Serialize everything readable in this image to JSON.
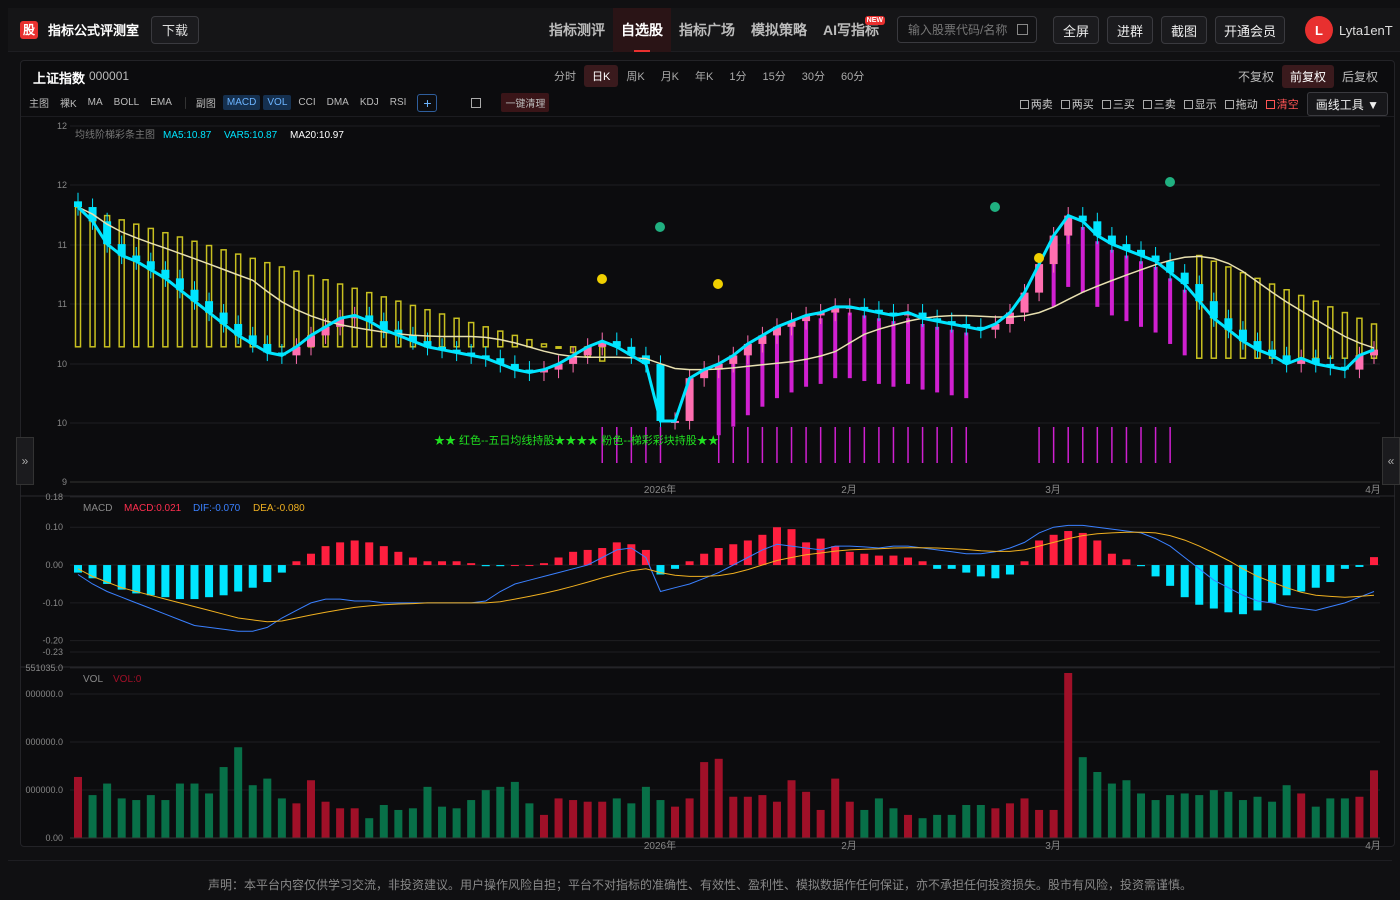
{
  "app": {
    "logo_char": "股",
    "brand": "指标公式评测室",
    "download": "下载"
  },
  "nav": [
    {
      "label": "指标测评",
      "active": false
    },
    {
      "label": "自选股",
      "active": true
    },
    {
      "label": "指标广场",
      "active": false
    },
    {
      "label": "模拟策略",
      "active": false
    },
    {
      "label": "AI写指标",
      "active": false,
      "tag": "NEW"
    }
  ],
  "search": {
    "placeholder": "输入股票代码/名称"
  },
  "top_buttons": [
    "全屏",
    "进群",
    "截图",
    "开通会员"
  ],
  "user": {
    "initial": "L",
    "name": "Lyta1enT"
  },
  "stock": {
    "name": "上证指数",
    "code": "000001"
  },
  "periods": [
    {
      "label": "分时",
      "on": false
    },
    {
      "label": "日K",
      "on": true
    },
    {
      "label": "周K",
      "on": false
    },
    {
      "label": "月K",
      "on": false
    },
    {
      "label": "年K",
      "on": false
    },
    {
      "label": "1分",
      "on": false
    },
    {
      "label": "15分",
      "on": false
    },
    {
      "label": "30分",
      "on": false
    },
    {
      "label": "60分",
      "on": false
    }
  ],
  "fq": [
    {
      "label": "不复权",
      "on": false
    },
    {
      "label": "前复权",
      "on": true
    },
    {
      "label": "后复权",
      "on": false
    }
  ],
  "main_ind": [
    "主图",
    "裸K",
    "MA",
    "BOLL",
    "EMA"
  ],
  "sub_ind": [
    {
      "label": "副图",
      "on": false
    },
    {
      "label": "MACD",
      "on": true
    },
    {
      "label": "VOL",
      "on": true
    },
    {
      "label": "CCI",
      "on": false
    },
    {
      "label": "DMA",
      "on": false
    },
    {
      "label": "KDJ",
      "on": false
    },
    {
      "label": "RSI",
      "on": false
    }
  ],
  "clear_all": "一键清理",
  "tools": [
    {
      "label": "两卖",
      "red": false
    },
    {
      "label": "两买",
      "red": false
    },
    {
      "label": "三买",
      "red": false
    },
    {
      "label": "三卖",
      "red": false
    },
    {
      "label": "显示",
      "red": false
    },
    {
      "label": "拖动",
      "red": false
    },
    {
      "label": "清空",
      "red": true
    }
  ],
  "draw_tools": "画线工具 ▼",
  "footer": "声明：本平台内容仅供学习交流，非投资建议。用户操作风险自担；平台不对指标的准确性、有效性、盈利性、模拟数据作任何保证，亦不承担任何投资损失。股市有风险，投资需谨慎。",
  "colors": {
    "up": "#ff6fb0",
    "down": "#00e5ff",
    "ma5": "#e02020",
    "var5": "#00e5ff",
    "ma20": "#e8e0b0",
    "band": "#c8c020",
    "stair": "#d020d0",
    "macd_up": "#ff1f3f",
    "macd_dn": "#00e5ff",
    "dif": "#3a80ff",
    "dea": "#f0b020",
    "vol_up": "#a01028",
    "vol_dn": "#087048"
  },
  "chart_data": {
    "type": "candlestick",
    "main": {
      "legend": "均线阶梯彩条主图",
      "ma5_label": "MA5:10.87",
      "var5_label": "VAR5:10.87",
      "ma20_label": "MA20:10.97",
      "y_ticks": [
        "12",
        "12",
        "11",
        "11",
        "10",
        "10",
        "9"
      ],
      "note": "★★ 红色--五日均线持股★★★★ 粉色--梯彩彩块持股★★",
      "x_labels": [
        "2026年",
        "2月",
        "3月",
        "4月"
      ]
    },
    "macd": {
      "name": "MACD",
      "macd_label": "MACD:0.021",
      "dif_label": "DIF:-0.070",
      "dea_label": "DEA:-0.080",
      "y_ticks": [
        "0.18",
        "0.10",
        "0.00",
        "-0.10",
        "-0.20",
        "-0.23"
      ]
    },
    "vol": {
      "name": "VOL",
      "vol_label": "VOL:0",
      "y_ticks": [
        "551035.0",
        "000000.0",
        "000000.0",
        "000000.0",
        "0.00"
      ],
      "x_labels": [
        "2026年",
        "2月",
        "3月",
        "4月"
      ]
    },
    "closes": [
      11.85,
      11.8,
      11.72,
      11.68,
      11.66,
      11.63,
      11.6,
      11.56,
      11.52,
      11.48,
      11.44,
      11.4,
      11.37,
      11.34,
      11.33,
      11.36,
      11.4,
      11.43,
      11.46,
      11.47,
      11.45,
      11.42,
      11.4,
      11.38,
      11.36,
      11.35,
      11.34,
      11.33,
      11.32,
      11.3,
      11.28,
      11.27,
      11.28,
      11.3,
      11.33,
      11.36,
      11.38,
      11.36,
      11.33,
      11.3,
      11.1,
      11.1,
      11.25,
      11.28,
      11.3,
      11.33,
      11.37,
      11.4,
      11.43,
      11.45,
      11.47,
      11.48,
      11.5,
      11.5,
      11.49,
      11.48,
      11.47,
      11.48,
      11.46,
      11.45,
      11.44,
      11.43,
      11.42,
      11.44,
      11.48,
      11.55,
      11.65,
      11.75,
      11.82,
      11.8,
      11.75,
      11.72,
      11.7,
      11.68,
      11.66,
      11.62,
      11.58,
      11.52,
      11.46,
      11.42,
      11.38,
      11.35,
      11.33,
      11.3,
      11.32,
      11.3,
      11.29,
      11.28,
      11.33,
      11.35
    ],
    "macd_hist": [
      -0.02,
      -0.035,
      -0.05,
      -0.065,
      -0.075,
      -0.08,
      -0.085,
      -0.09,
      -0.09,
      -0.085,
      -0.08,
      -0.07,
      -0.06,
      -0.045,
      -0.02,
      0.01,
      0.03,
      0.05,
      0.06,
      0.065,
      0.06,
      0.05,
      0.035,
      0.02,
      0.01,
      0.01,
      0.01,
      0.005,
      -0.003,
      -0.003,
      0.0,
      0.0,
      0.005,
      0.02,
      0.035,
      0.04,
      0.045,
      0.06,
      0.055,
      0.04,
      -0.025,
      -0.01,
      0.01,
      0.03,
      0.045,
      0.055,
      0.065,
      0.08,
      0.1,
      0.095,
      0.06,
      0.07,
      0.05,
      0.035,
      0.03,
      0.025,
      0.025,
      0.02,
      0.01,
      -0.01,
      -0.01,
      -0.02,
      -0.03,
      -0.035,
      -0.025,
      0.01,
      0.065,
      0.08,
      0.09,
      0.085,
      0.065,
      0.03,
      0.015,
      -0.003,
      -0.03,
      -0.055,
      -0.085,
      -0.105,
      -0.115,
      -0.125,
      -0.13,
      -0.12,
      -0.1,
      -0.08,
      -0.07,
      -0.06,
      -0.045,
      -0.01,
      -0.005,
      0.021
    ],
    "dif": [
      -0.025,
      -0.05,
      -0.07,
      -0.085,
      -0.1,
      -0.115,
      -0.13,
      -0.145,
      -0.16,
      -0.165,
      -0.17,
      -0.175,
      -0.175,
      -0.165,
      -0.14,
      -0.12,
      -0.1,
      -0.09,
      -0.09,
      -0.095,
      -0.095,
      -0.1,
      -0.1,
      -0.1,
      -0.1,
      -0.1,
      -0.1,
      -0.1,
      -0.095,
      -0.07,
      -0.05,
      -0.04,
      -0.03,
      -0.02,
      -0.01,
      0.0,
      0.02,
      0.04,
      0.045,
      0.02,
      -0.07,
      -0.06,
      -0.05,
      -0.035,
      -0.02,
      0.0,
      0.02,
      0.04,
      0.055,
      0.05,
      0.045,
      0.04,
      0.05,
      0.05,
      0.048,
      0.045,
      0.05,
      0.05,
      0.045,
      0.04,
      0.035,
      0.03,
      0.03,
      0.035,
      0.045,
      0.06,
      0.085,
      0.1,
      0.105,
      0.105,
      0.1,
      0.095,
      0.09,
      0.085,
      0.07,
      0.05,
      0.02,
      -0.01,
      -0.04,
      -0.06,
      -0.08,
      -0.095,
      -0.1,
      -0.11,
      -0.115,
      -0.12,
      -0.11,
      -0.1,
      -0.085,
      -0.07
    ],
    "dea": [
      -0.01,
      -0.03,
      -0.045,
      -0.06,
      -0.07,
      -0.08,
      -0.09,
      -0.1,
      -0.11,
      -0.12,
      -0.13,
      -0.14,
      -0.145,
      -0.15,
      -0.148,
      -0.14,
      -0.132,
      -0.125,
      -0.118,
      -0.112,
      -0.108,
      -0.105,
      -0.103,
      -0.102,
      -0.1,
      -0.1,
      -0.1,
      -0.1,
      -0.1,
      -0.097,
      -0.09,
      -0.083,
      -0.075,
      -0.066,
      -0.056,
      -0.045,
      -0.034,
      -0.024,
      -0.015,
      -0.01,
      -0.02,
      -0.027,
      -0.03,
      -0.03,
      -0.028,
      -0.022,
      -0.012,
      0.0,
      0.012,
      0.02,
      0.027,
      0.032,
      0.037,
      0.04,
      0.042,
      0.043,
      0.045,
      0.046,
      0.046,
      0.045,
      0.043,
      0.041,
      0.038,
      0.036,
      0.036,
      0.04,
      0.05,
      0.06,
      0.07,
      0.078,
      0.083,
      0.085,
      0.087,
      0.087,
      0.085,
      0.078,
      0.066,
      0.05,
      0.032,
      0.012,
      -0.01,
      -0.03,
      -0.045,
      -0.06,
      -0.072,
      -0.08,
      -0.083,
      -0.085,
      -0.083,
      -0.08
    ],
    "volume": [
      0.37,
      0.26,
      0.33,
      0.24,
      0.23,
      0.26,
      0.23,
      0.33,
      0.33,
      0.27,
      0.43,
      0.55,
      0.32,
      0.36,
      0.24,
      0.21,
      0.35,
      0.22,
      0.18,
      0.18,
      0.12,
      0.2,
      0.17,
      0.18,
      0.31,
      0.19,
      0.18,
      0.23,
      0.29,
      0.31,
      0.34,
      0.21,
      0.14,
      0.24,
      0.23,
      0.22,
      0.22,
      0.24,
      0.21,
      0.31,
      0.23,
      0.19,
      0.24,
      0.46,
      0.48,
      0.25,
      0.25,
      0.26,
      0.22,
      0.35,
      0.28,
      0.17,
      0.36,
      0.22,
      0.17,
      0.24,
      0.18,
      0.14,
      0.12,
      0.14,
      0.14,
      0.2,
      0.2,
      0.18,
      0.21,
      0.24,
      0.17,
      0.17,
      1.0,
      0.49,
      0.4,
      0.33,
      0.35,
      0.27,
      0.23,
      0.26,
      0.27,
      0.26,
      0.29,
      0.28,
      0.23,
      0.25,
      0.22,
      0.32,
      0.27,
      0.19,
      0.24,
      0.24,
      0.25,
      0.41
    ]
  }
}
